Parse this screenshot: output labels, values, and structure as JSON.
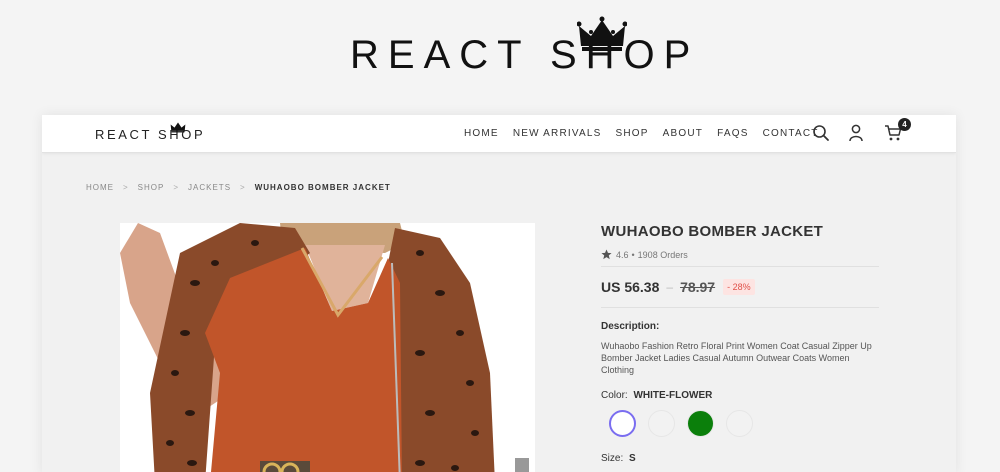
{
  "brand": {
    "hero_wordmark": "REACT SHOP",
    "nav_wordmark": "REACT SHOP"
  },
  "nav": {
    "links": [
      "HOME",
      "NEW ARRIVALS",
      "SHOP",
      "ABOUT",
      "FAQS",
      "CONTACT"
    ],
    "cart_count": "4"
  },
  "breadcrumb": {
    "items": [
      "HOME",
      "SHOP",
      "JACKETS"
    ],
    "separator": ">",
    "current": "WUHAOBO BOMBER JACKET"
  },
  "product": {
    "title": "WUHAOBO BOMBER JACKET",
    "rating": "4.6",
    "orders": "1908 Orders",
    "rating_dot": "•",
    "price": "US 56.38",
    "price_dash": "–",
    "old_price": "78.97",
    "discount": "- 28%",
    "description_label": "Description:",
    "description": "Wuhaobo Fashion Retro Floral Print Women Coat Casual Zipper Up Bomber Jacket Ladies Casual Autumn Outwear Coats Women Clothing",
    "color_label": "Color:",
    "color_value": "WHITE-FLOWER",
    "size_label": "Size:",
    "size_value": "S",
    "swatches": [
      "#ffffff",
      "#f2f2f2",
      "#0b7f0b",
      "#f2f2f2"
    ]
  },
  "colors": {
    "accent": "#7a6df0",
    "discount": "#e0514a",
    "discount_bg": "#fde4e2"
  }
}
